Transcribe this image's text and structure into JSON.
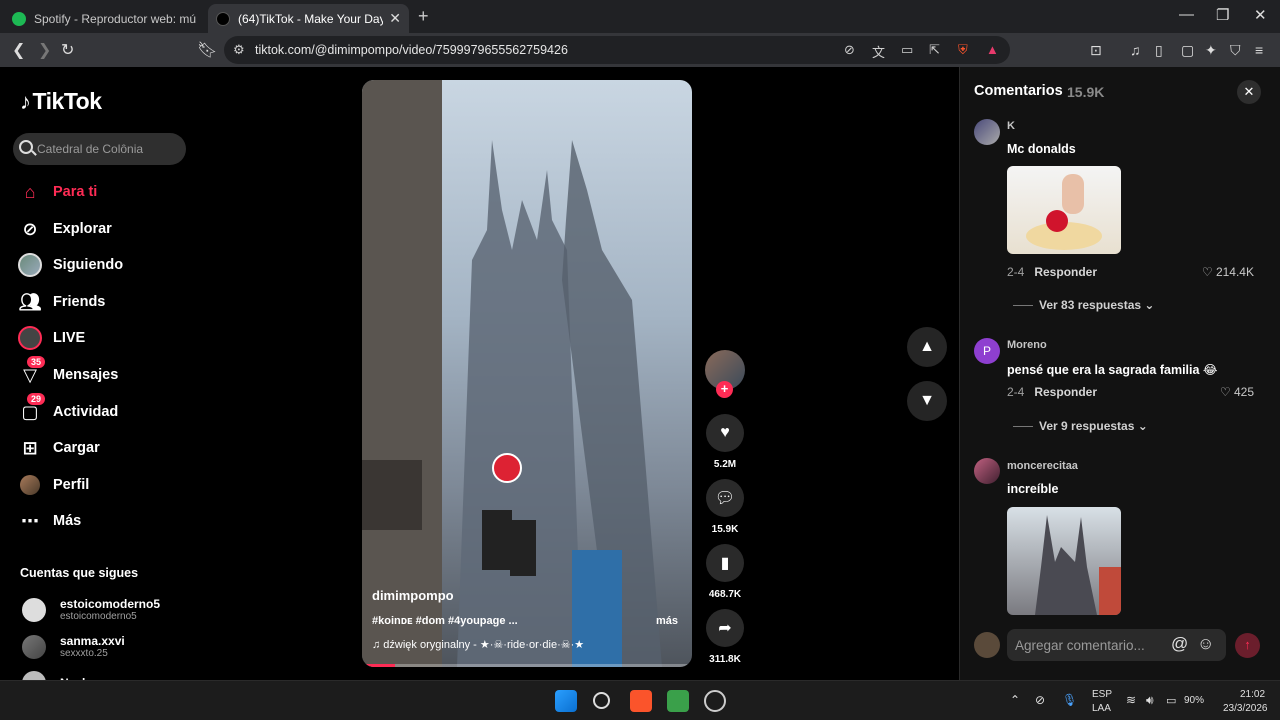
{
  "browser": {
    "tabs": [
      {
        "title": "Spotify - Reproductor web: música p",
        "active": false
      },
      {
        "title": "(64)TikTok - Make Your Day",
        "active": true
      }
    ],
    "url": "tiktok.com/@dimimpompo/video/7599979655562759426"
  },
  "sidebar": {
    "logo": "TikTok",
    "search_placeholder": "Catedral de Colônia",
    "nav": [
      {
        "label": "Para ti",
        "icon": "home-icon"
      },
      {
        "label": "Explorar",
        "icon": "compass-icon"
      },
      {
        "label": "Siguiendo",
        "icon": "following-avatar-icon"
      },
      {
        "label": "Friends",
        "icon": "friends-icon"
      },
      {
        "label": "LIVE",
        "icon": "live-icon"
      },
      {
        "label": "Mensajes",
        "icon": "messages-icon",
        "badge": "35"
      },
      {
        "label": "Actividad",
        "icon": "activity-icon",
        "badge": "29"
      },
      {
        "label": "Cargar",
        "icon": "upload-icon"
      },
      {
        "label": "Perfil",
        "icon": "profile-avatar-icon"
      },
      {
        "label": "Más",
        "icon": "more-icon"
      }
    ],
    "following_title": "Cuentas que sigues",
    "following": [
      {
        "name": "estoicomoderno5",
        "user": "estoicomoderno5"
      },
      {
        "name": "sanma.xxvi",
        "user": "sexxxto.25"
      },
      {
        "name": "Nacho",
        "user": ""
      }
    ]
  },
  "video": {
    "author": "dimimpompo",
    "tags": "#koinᴅᴇ #dom #4youpage ...",
    "more": "más",
    "music": "♫  dźwięk oryginalny - ★·☠·ride·or·die·☠·★",
    "progress": 0.1,
    "likes": "5.2M",
    "comments": "15.9K",
    "saves": "468.7K",
    "shares": "311.8K"
  },
  "comments_panel": {
    "title": "Comentarios",
    "count": "15.9K",
    "input_placeholder": "Agregar comentario...",
    "reply_label": "Responder",
    "comments": [
      {
        "user": "K",
        "text": "Mc donalds",
        "date": "2-4",
        "likes": "214.4K",
        "replies": "Ver 83 respuestas"
      },
      {
        "user": "Moreno",
        "avatar_letter": "P",
        "text": "pensé que era la sagrada familia 😂",
        "date": "2-4",
        "likes": "425",
        "replies": "Ver 9 respuestas"
      },
      {
        "user": "moncerecitaa",
        "text": "increíble"
      }
    ]
  },
  "taskbar": {
    "lang1": "ESP",
    "lang2": "LAA",
    "battery": "90%",
    "time": "21:02",
    "date": "23/3/2026"
  },
  "colors": {
    "accent": "#fe2c55",
    "panel": "#121212"
  }
}
